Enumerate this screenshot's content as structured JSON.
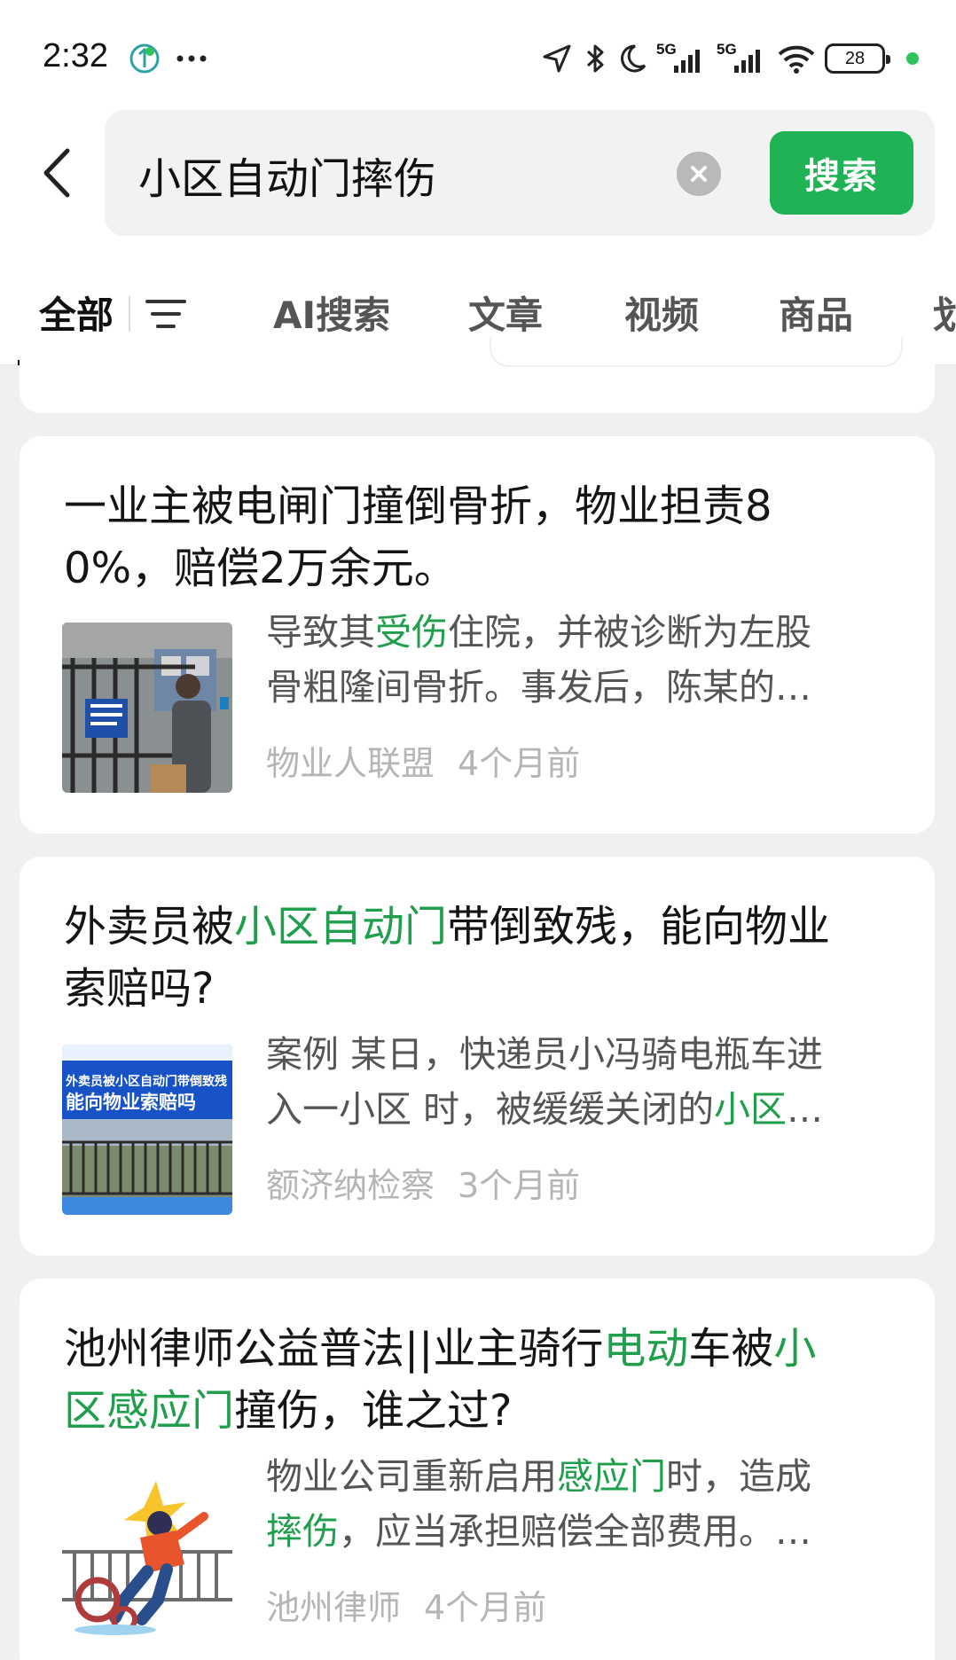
{
  "status_bar": {
    "time": "2:32",
    "network_1": "5G",
    "network_2": "5G",
    "battery": "28",
    "accent": "#2fc35a"
  },
  "search": {
    "query": "小区自动门摔伤",
    "button_label": "搜索",
    "button_color": "#1fb356"
  },
  "tabs": [
    {
      "label": "全部",
      "active": true
    },
    {
      "label": "AI搜索"
    },
    {
      "label": "文章"
    },
    {
      "label": "视频"
    },
    {
      "label": "商品"
    },
    {
      "label": "划"
    }
  ],
  "results": [
    {
      "title": [
        {
          "text": "一业主被电闸门撞倒骨折，物业担责8",
          "hl": false
        },
        {
          "text": "0%，赔偿2万余元。",
          "hl": false
        }
      ],
      "snippet_line1": [
        {
          "text": "导致其",
          "hl": false
        },
        {
          "text": "受伤",
          "hl": true
        },
        {
          "text": "住院，并被诊断为左股",
          "hl": false
        }
      ],
      "snippet_line2": [
        {
          "text": "骨粗隆间骨折。事发后，陈某的…",
          "hl": false
        }
      ],
      "source": "物业人联盟",
      "time": "4个月前",
      "thumbnail": "person-at-gate-photo"
    },
    {
      "title": [
        {
          "text": "外卖员被",
          "hl": false
        },
        {
          "text": "小区自动门",
          "hl": true
        },
        {
          "text": "带倒致残，能向物业",
          "hl": false
        },
        {
          "text": "索赔吗?",
          "hl": false
        }
      ],
      "snippet_line1": [
        {
          "text": "案例 某日，快递员小冯骑电瓶车进",
          "hl": false
        }
      ],
      "snippet_line2": [
        {
          "text": "入一小区 时，被缓缓关闭的",
          "hl": false
        },
        {
          "text": "小区",
          "hl": true
        },
        {
          "text": "…",
          "hl": false
        }
      ],
      "source": "额济纳检察",
      "time": "3个月前",
      "thumbnail": "news-banner-gate-photo",
      "thumb_text_1": "外卖员被小区自动门带倒致残",
      "thumb_text_2": "能向物业索赔吗"
    },
    {
      "title": [
        {
          "text": "池州律师公益普法||业主骑行",
          "hl": false
        },
        {
          "text": "电动",
          "hl": true
        },
        {
          "text": "车被",
          "hl": false
        },
        {
          "text": "小",
          "hl": true
        },
        {
          "text": "区感应门",
          "hl": true
        },
        {
          "text": "撞伤，谁之过?",
          "hl": false
        }
      ],
      "snippet_line1": [
        {
          "text": "物业公司重新启用",
          "hl": false
        },
        {
          "text": "感应门",
          "hl": true
        },
        {
          "text": "时，造成",
          "hl": false
        }
      ],
      "snippet_line2": [
        {
          "text": "摔伤",
          "hl": true
        },
        {
          "text": "，应当承担赔偿全部费用。…",
          "hl": false
        }
      ],
      "source": "池州律师",
      "time": "4个月前",
      "thumbnail": "falling-rider-illustration"
    }
  ],
  "colors": {
    "highlight": "#1f9e4b",
    "meta_gray": "#b5b5b5",
    "page_bg": "#f0f0f0"
  }
}
